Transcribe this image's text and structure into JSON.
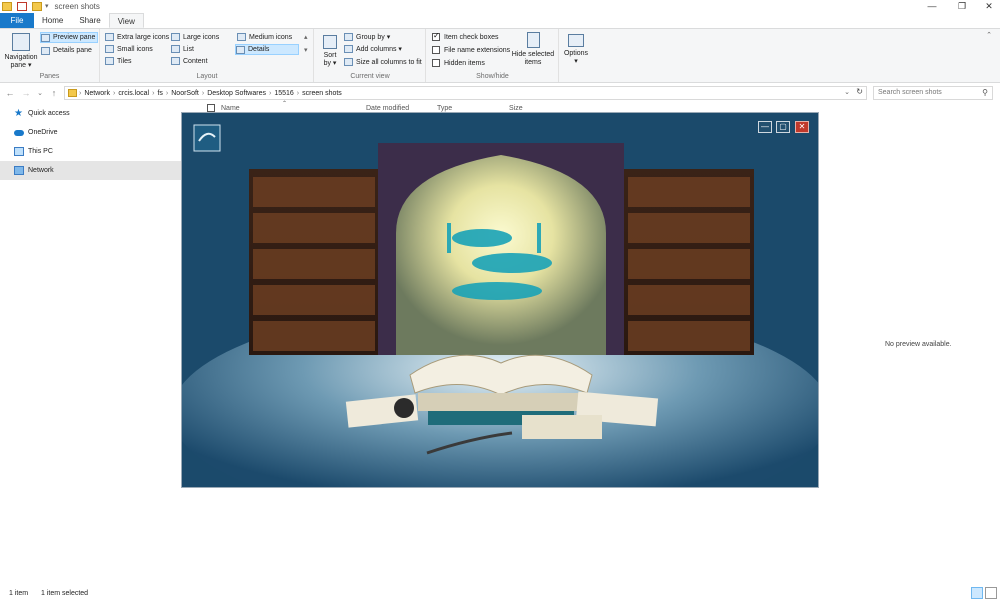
{
  "window": {
    "title": "screen shots",
    "controls": {
      "minimize": "—",
      "maximize": "❐",
      "close": "✕"
    }
  },
  "ribbon": {
    "tabs": [
      "File",
      "Home",
      "Share",
      "View"
    ],
    "active_tab": "View",
    "panes": {
      "navigation_pane": "Navigation pane",
      "preview_pane": "Preview pane",
      "details_pane": "Details pane",
      "label": "Panes"
    },
    "layout": {
      "extra_large_icons": "Extra large icons",
      "large_icons": "Large icons",
      "medium_icons": "Medium icons",
      "small_icons": "Small icons",
      "list": "List",
      "details": "Details",
      "tiles": "Tiles",
      "content": "Content",
      "label": "Layout"
    },
    "current_view": {
      "sort_by": "Sort by",
      "group_by": "Group by",
      "add_columns": "Add columns",
      "size_columns": "Size all columns to fit",
      "label": "Current view"
    },
    "show_hide": {
      "item_checkboxes": "Item check boxes",
      "file_name_extensions": "File name extensions",
      "hidden_items": "Hidden items",
      "hide_selected": "Hide selected items",
      "label": "Show/hide",
      "item_checkboxes_checked": true
    },
    "options": "Options"
  },
  "address": {
    "crumbs": [
      "Network",
      "crcis.local",
      "fs",
      "NoorSoft",
      "Desktop Softwares",
      "15516",
      "screen shots"
    ],
    "search_placeholder": "Search screen shots"
  },
  "navpane": {
    "items": [
      "Quick access",
      "OneDrive",
      "This PC",
      "Network"
    ],
    "selected": "Network"
  },
  "columns": [
    "Name",
    "Date modified",
    "Type",
    "Size"
  ],
  "preview": {
    "no_preview": "No preview available."
  },
  "status": {
    "items": "1 item",
    "selected": "1 item selected"
  },
  "colors": {
    "accent": "#1979ca",
    "ribbon_bg": "#f5f6f7",
    "preview_bg": "#1c4a6c"
  }
}
